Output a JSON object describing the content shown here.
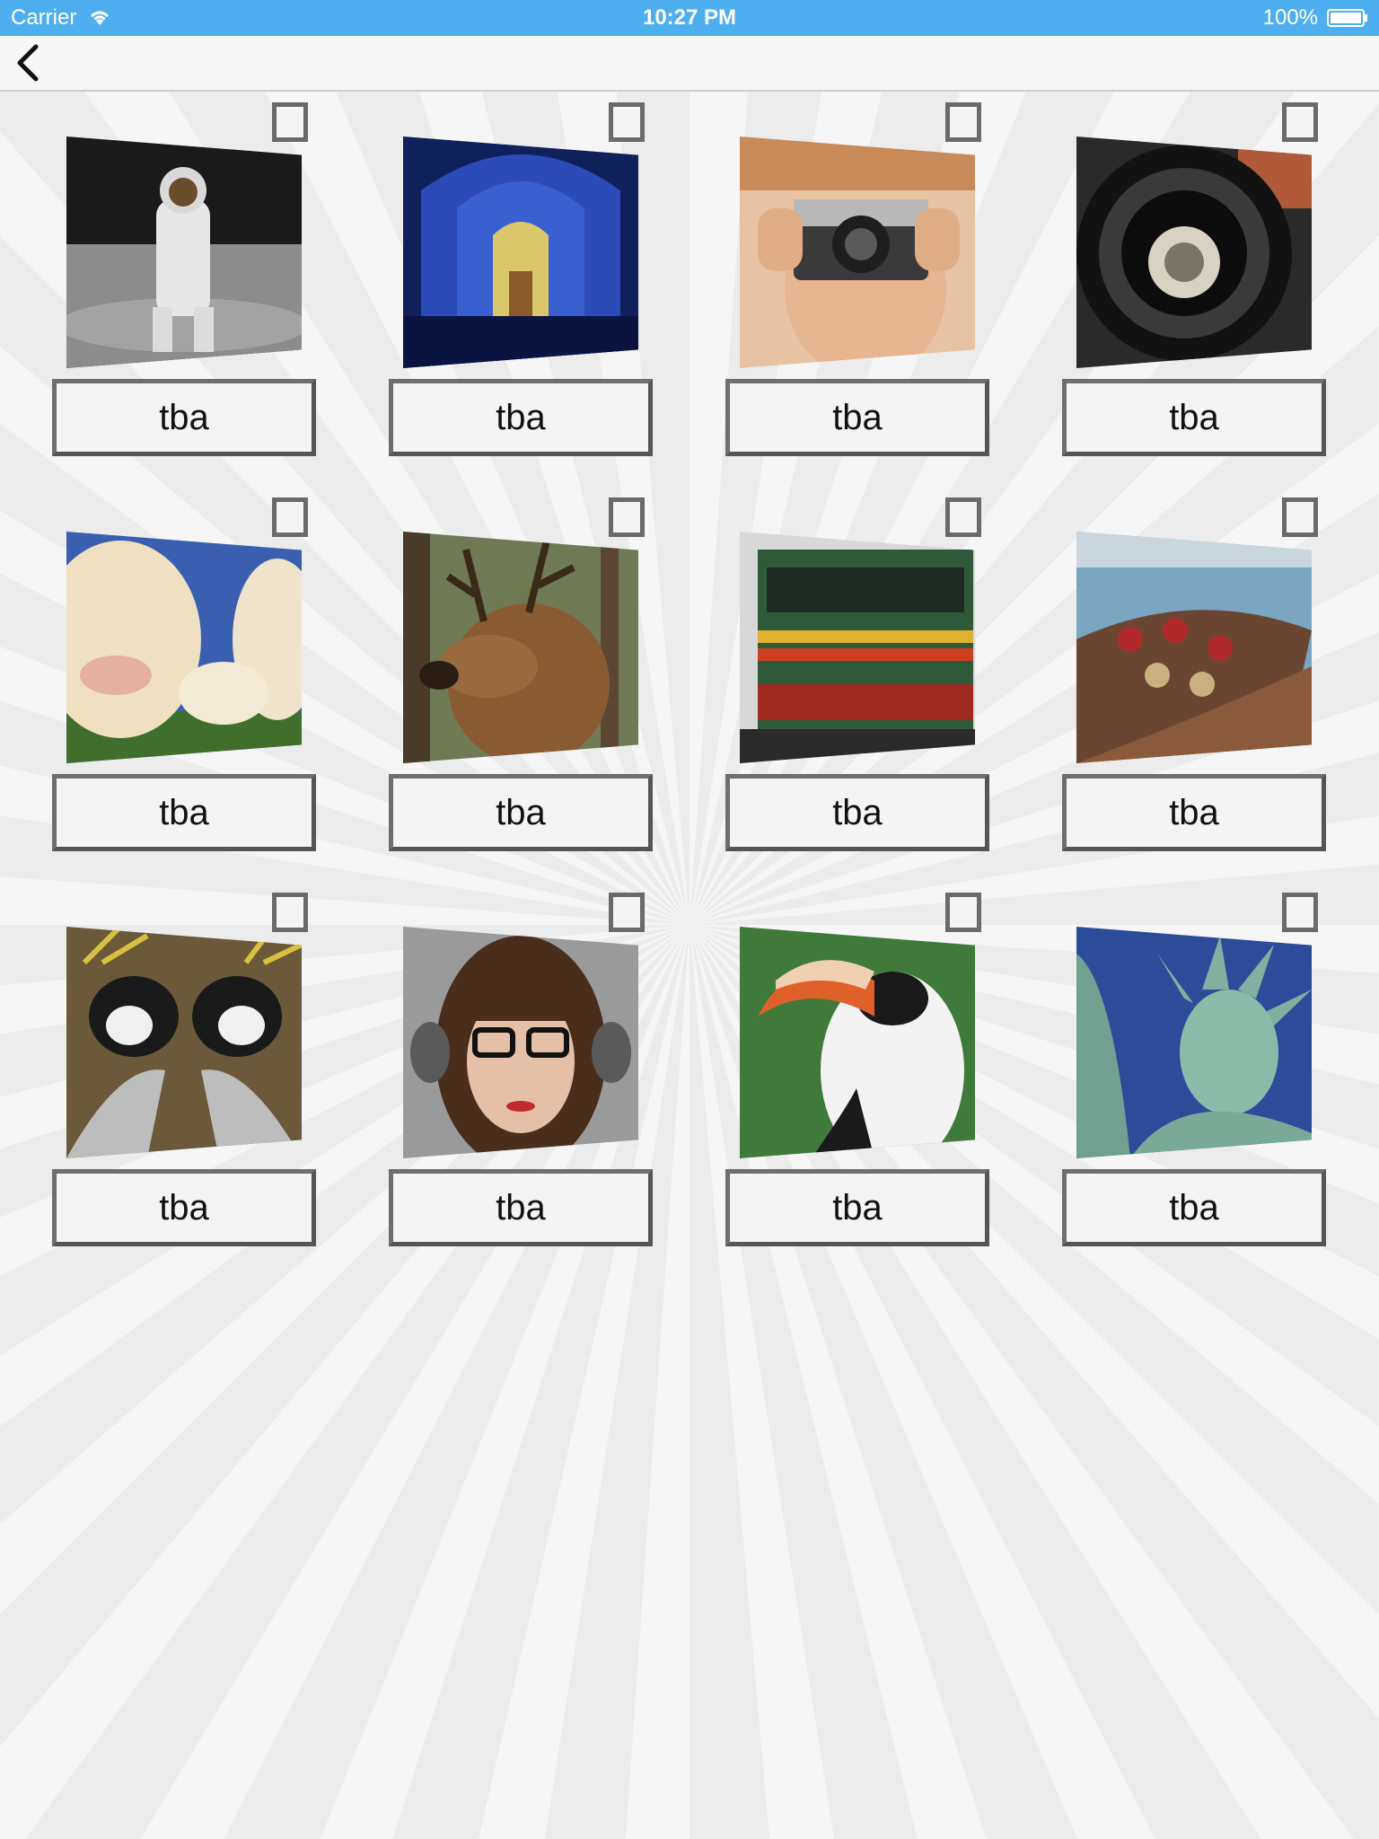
{
  "status_bar": {
    "carrier": "Carrier",
    "time": "10:27 PM",
    "battery": "100%"
  },
  "nav": {
    "back_icon": "chevron-left-icon"
  },
  "items": [
    {
      "label": "tba",
      "image": "astronaut-on-moon"
    },
    {
      "label": "tba",
      "image": "blue-cathedral-hall"
    },
    {
      "label": "tba",
      "image": "woman-with-camera"
    },
    {
      "label": "tba",
      "image": "camera-lens-closeup"
    },
    {
      "label": "tba",
      "image": "cows-in-field"
    },
    {
      "label": "tba",
      "image": "deer-in-forest"
    },
    {
      "label": "tba",
      "image": "locomotive-train"
    },
    {
      "label": "tba",
      "image": "fishing-boat-with-buoys"
    },
    {
      "label": "tba",
      "image": "crowned-cranes"
    },
    {
      "label": "tba",
      "image": "woman-with-headphones"
    },
    {
      "label": "tba",
      "image": "hornbill-bird"
    },
    {
      "label": "tba",
      "image": "statue-of-liberty"
    }
  ],
  "colors": {
    "status_bar": "#4daef0",
    "box_border": "#6e6e6e"
  }
}
